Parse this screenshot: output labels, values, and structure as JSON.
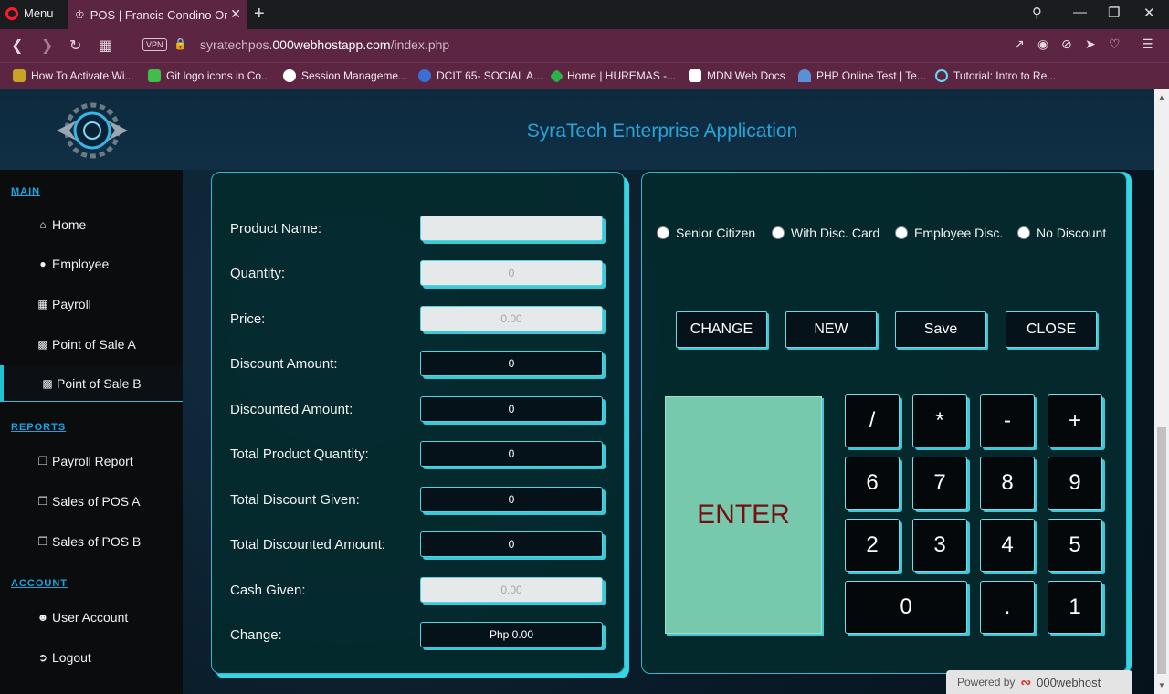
{
  "browser": {
    "menu_label": "Menu",
    "tab_title": "POS | Francis Condino Ong",
    "url_prefix": "syratechpos.",
    "url_domain": "000webhostapp.com",
    "url_path": "/index.php",
    "vpn_label": "VPN",
    "bookmarks": [
      "How To Activate Wi...",
      "Git logo icons in Co...",
      "Session Manageme...",
      "DCIT 65- SOCIAL A...",
      "Home | HUREMAS -...",
      "MDN Web Docs",
      "PHP Online Test | Te...",
      "Tutorial: Intro to Re..."
    ]
  },
  "header": {
    "title": "SyraTech Enterprise Application"
  },
  "sidebar": {
    "main_label": "MAIN",
    "reports_label": "REPORTS",
    "account_label": "ACCOUNT",
    "items": {
      "home": "Home",
      "employee": "Employee",
      "payroll": "Payroll",
      "pos_a": "Point of Sale A",
      "pos_b": "Point of Sale B",
      "payroll_report": "Payroll Report",
      "sales_pos_a": "Sales of POS A",
      "sales_pos_b": "Sales of POS B",
      "user_account": "User Account",
      "logout": "Logout"
    }
  },
  "form": {
    "product_name_label": "Product Name:",
    "product_name_value": "",
    "quantity_label": "Quantity:",
    "quantity_value": "0",
    "price_label": "Price:",
    "price_value": "0.00",
    "discount_amount_label": "Discount Amount:",
    "discount_amount_value": "0",
    "discounted_amount_label": "Discounted Amount:",
    "discounted_amount_value": "0",
    "total_qty_label": "Total Product Quantity:",
    "total_qty_value": "0",
    "total_discount_label": "Total Discount Given:",
    "total_discount_value": "0",
    "total_discounted_label": "Total Discounted Amount:",
    "total_discounted_value": "0",
    "cash_given_label": "Cash Given:",
    "cash_given_value": "0.00",
    "change_label": "Change:",
    "change_value": "Php 0.00"
  },
  "discounts": {
    "senior": "Senior Citizen",
    "disc_card": "With Disc. Card",
    "employee": "Employee Disc.",
    "none": "No Discount"
  },
  "actions": {
    "change": "CHANGE",
    "new": "NEW",
    "save": "Save",
    "close": "CLOSE"
  },
  "keypad": {
    "enter": "ENTER",
    "divide": "/",
    "multiply": "*",
    "minus": "-",
    "plus": "+",
    "k6": "6",
    "k7": "7",
    "k8": "8",
    "k9": "9",
    "k2": "2",
    "k3": "3",
    "k4": "4",
    "k5": "5",
    "k0": "0",
    "dot": ".",
    "k1": "1"
  },
  "footer": {
    "powered_by": "Powered by",
    "brand": "000webhost"
  },
  "colors": {
    "accent": "#34d6e4",
    "tab_bar": "#5c2542",
    "enter_button": "#76c9ad",
    "title": "#29a3d6"
  }
}
